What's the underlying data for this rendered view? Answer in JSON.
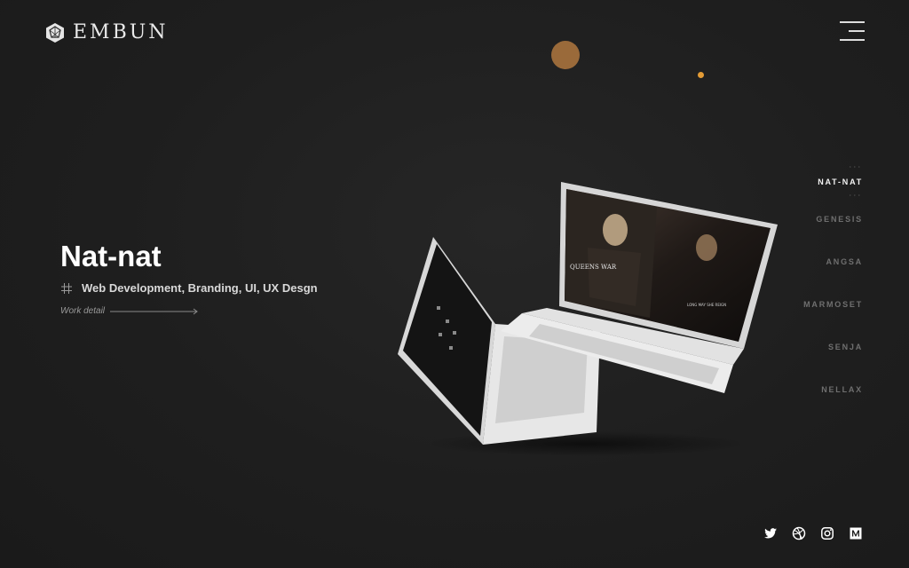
{
  "brand": {
    "name": "EMBUN"
  },
  "hero": {
    "title": "Nat-nat",
    "tags": "Web Development, Branding, UI, UX Desgn",
    "work_link": "Work detail"
  },
  "projects": [
    {
      "label": "NAT-NAT",
      "active": true
    },
    {
      "label": "GENESIS",
      "active": false
    },
    {
      "label": "ANGSA",
      "active": false
    },
    {
      "label": "MARMOSET",
      "active": false
    },
    {
      "label": "SENJA",
      "active": false
    },
    {
      "label": "NELLAX",
      "active": false
    }
  ],
  "mockup_screen": {
    "headline": "QUEENS WAR",
    "quote": "LONG MAY SHE REIGN"
  },
  "social": [
    "twitter-icon",
    "dribbble-icon",
    "instagram-icon",
    "medium-icon"
  ],
  "colors": {
    "background": "#1e1e1e",
    "orb": "#9a6a3a",
    "orb_small": "#e39b35",
    "active_nav": "#f2f2f2",
    "inactive_nav": "#6f6f6f"
  }
}
